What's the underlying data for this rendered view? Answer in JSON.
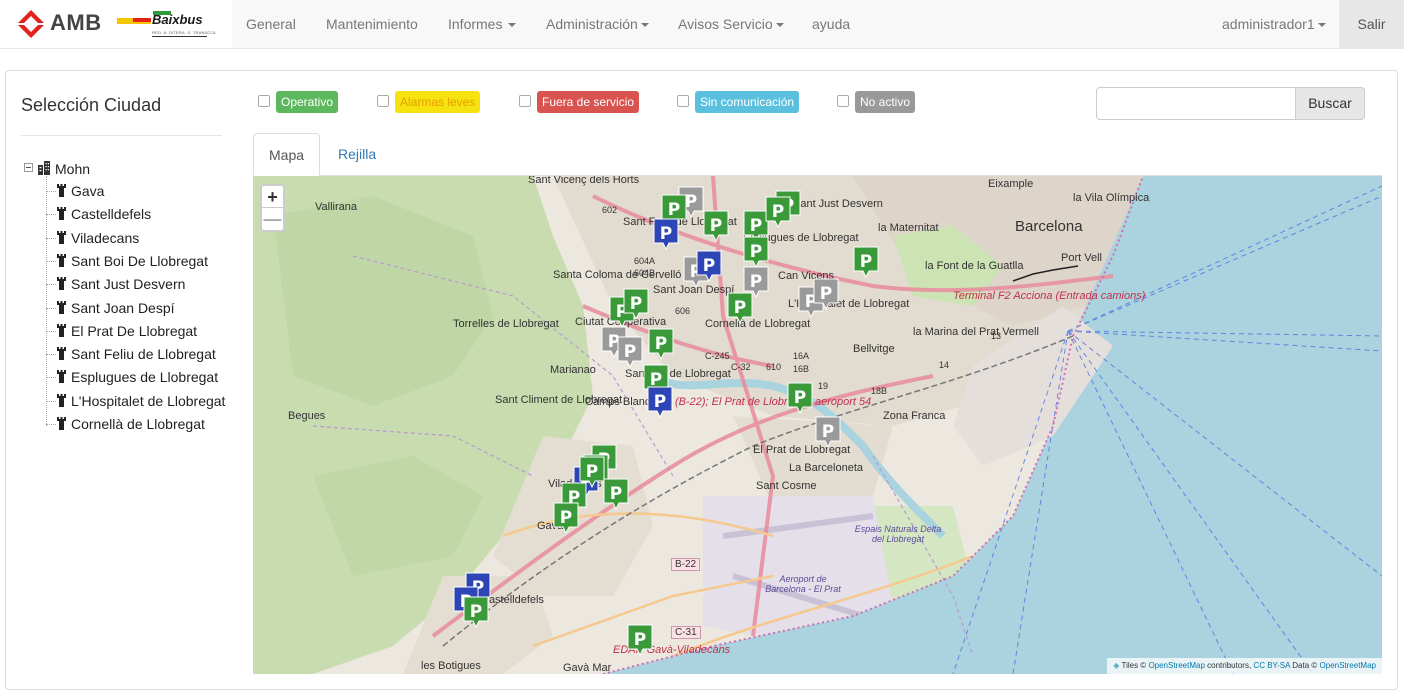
{
  "brand": {
    "amb": "AMB",
    "baix": "Baixbus",
    "baix_sub": "RED. A. DITERA. S. TRANSCOL"
  },
  "nav": {
    "items": [
      {
        "label": "General",
        "dropdown": false
      },
      {
        "label": "Mantenimiento",
        "dropdown": false
      },
      {
        "label": "Informes",
        "dropdown": true
      },
      {
        "label": "Administración",
        "dropdown": true
      },
      {
        "label": "Avisos Servicio",
        "dropdown": true
      },
      {
        "label": "ayuda",
        "dropdown": false
      }
    ],
    "user": "administrador1",
    "logout": "Salir"
  },
  "sidebar": {
    "title": "Selección Ciudad",
    "root": "Mohn",
    "cities": [
      "Gava",
      "Castelldefels",
      "Viladecans",
      "Sant Boi De Llobregat",
      "Sant Just Desvern",
      "Sant Joan Despí",
      "El Prat De Llobregat",
      "Sant Feliu de Llobregat",
      "Esplugues de Llobregat",
      "L'Hospitalet de Llobregat",
      "Cornellà de Llobregat"
    ]
  },
  "filters": [
    {
      "label": "Operativo",
      "color": "#5cb85c",
      "text_color": "#ffffff"
    },
    {
      "label": "Alarmas leves",
      "color": "#f0e014",
      "text_color": "#e8a000"
    },
    {
      "label": "Fuera de servicio",
      "color": "#d9534f",
      "text_color": "#ffffff"
    },
    {
      "label": "Sin comunicación",
      "color": "#5bc0de",
      "text_color": "#ffffff"
    },
    {
      "label": "No activo",
      "color": "#999999",
      "text_color": "#ffffff"
    }
  ],
  "search": {
    "placeholder": "",
    "button": "Buscar"
  },
  "tabs": {
    "active": "Mapa",
    "other": "Rejilla"
  },
  "map": {
    "zoom_in": "+",
    "zoom_out": "—",
    "attribution": {
      "prefix": "Tiles ©",
      "osm": "OpenStreetMap",
      "contributors": "contributors,",
      "license": "CC BY-SA",
      "data": "Data ©",
      "osm2": "OpenStreetMap"
    },
    "labels": [
      "Sant Vicenç dels Horts",
      "Sant Feliu de Llobregat",
      "Vallirana",
      "Santa Coloma de Cervelló",
      "Sant Joan Despí",
      "Torrelles de Llobregat",
      "Ciutat Cooperativa",
      "Cornellà de Llobregat",
      "Marianao",
      "Sant Boi de Llobregat",
      "Camps Blancs",
      "Sant Climent de Llobregat",
      "Begues",
      "Esplugues de Llobregat",
      "Sant Just Desvern",
      "Can Vicens",
      "L'Hospitalet de Llobregat",
      "Bellvitge",
      "Barcelona",
      "Eixample",
      "la Vila Olímpica",
      "la Maternitat",
      "Port Vell",
      "la Font de la Guatlla",
      "Terminal F2 Acciona (Entrada camions)",
      "la Marina del Prat Vermell",
      "Zona Franca",
      "El Prat de Llobregat",
      "La Barceloneta",
      "Sant Cosme",
      "Viladecans",
      "Gavà",
      "Castelldefels",
      "les Botigues",
      "Gavà Mar",
      "Aeroport de Barcelona - El Prat",
      "Espais Naturals Delta del Llobregat",
      "EDAR Gavà-Viladecans",
      "B-22",
      "C-31",
      "C-245",
      "C-32",
      "602",
      "604A",
      "604B",
      "606",
      "610",
      "16A",
      "16B",
      "18B",
      "19",
      "13",
      "14",
      "(B-22); El Prat de Llobregat; aeroport 54"
    ]
  }
}
